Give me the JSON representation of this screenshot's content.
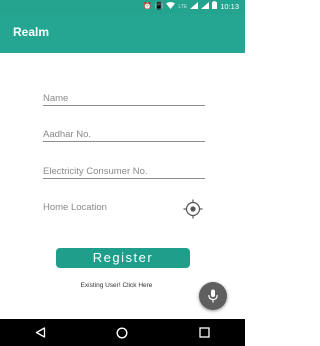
{
  "status_bar": {
    "icons": [
      "alarm-icon",
      "vibrate-icon",
      "wifi-icon",
      "signal-icon",
      "battery-icon"
    ],
    "network_label": "LTE",
    "time": "10:13",
    "color": "#24a38f"
  },
  "app_bar": {
    "title": "Realm",
    "color": "#25a692"
  },
  "form": {
    "name_placeholder": "Name",
    "aadhar_placeholder": "Aadhar No.",
    "electricity_placeholder": "Electricity Consumer No.",
    "home_location_label": "Home Location",
    "location_icon": "gps-target-icon"
  },
  "register": {
    "label": "Register",
    "color": "#1f9e8b"
  },
  "existing_user_link": "Existing User! Click Here",
  "fab": {
    "icon": "mic-icon",
    "color": "#5f5f5f"
  },
  "nav_bar": {
    "icons": [
      "back-icon",
      "home-icon",
      "recents-icon"
    ]
  }
}
